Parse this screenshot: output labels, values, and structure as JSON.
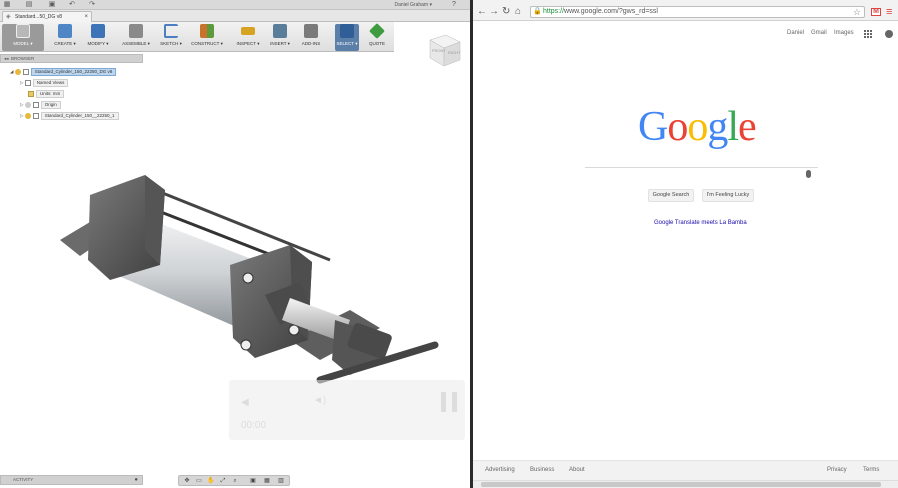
{
  "fusion": {
    "user": "Daniel Graham ▾",
    "document_tab": "Standard...50_DG v8",
    "toolbar": [
      {
        "label": "MODEL ▾",
        "color": "#8a8a8a"
      },
      {
        "label": "CREATE ▾",
        "color": "#4f86c6"
      },
      {
        "label": "MODIFY ▾",
        "color": "#3d74b8"
      },
      {
        "label": "ASSEMBLE ▾",
        "color": "#6d6d6d"
      },
      {
        "label": "SKETCH ▾",
        "color": "#4a7fc1"
      },
      {
        "label": "CONSTRUCT ▾",
        "color": "#c9722b"
      },
      {
        "label": "INSPECT ▾",
        "color": "#d7a323"
      },
      {
        "label": "INSERT ▾",
        "color": "#5a7d9a"
      },
      {
        "label": "ADD-INS",
        "color": "#6a6a6a"
      },
      {
        "label": "SELECT ▾",
        "color": "#2f5f96"
      },
      {
        "label": "QUOTE",
        "color": "#3f9b3f"
      }
    ],
    "viewcube": {
      "front": "FRONT",
      "right": "RIGHT"
    },
    "browser_title": "BROWSER",
    "tree": [
      {
        "label": "Standard_Cylinder_150_22250_DG v8"
      },
      {
        "label": "Named Views"
      },
      {
        "label": "Units: mm"
      },
      {
        "label": "Origin"
      },
      {
        "label": "Standard_Cylinder_150__22250_1"
      }
    ],
    "activity": "ACTIVITY",
    "video_time": "00:00"
  },
  "chrome": {
    "url_scheme": "https://",
    "url_rest": "www.google.com/?gws_rd=ssl",
    "top_links": [
      "Daniel",
      "Gmail",
      "Images"
    ],
    "logo_letters": [
      {
        "ch": "G",
        "color": "#4285f4"
      },
      {
        "ch": "o",
        "color": "#ea4335"
      },
      {
        "ch": "o",
        "color": "#fbbc05"
      },
      {
        "ch": "g",
        "color": "#4285f4"
      },
      {
        "ch": "l",
        "color": "#34a853"
      },
      {
        "ch": "e",
        "color": "#ea4335"
      }
    ],
    "search_button": "Google Search",
    "lucky_button": "I'm Feeling Lucky",
    "doodle_link": "Google Translate meets La Bamba",
    "footer_left": [
      "Advertising",
      "Business",
      "About"
    ],
    "footer_right": [
      "Privacy",
      "Terms"
    ]
  }
}
